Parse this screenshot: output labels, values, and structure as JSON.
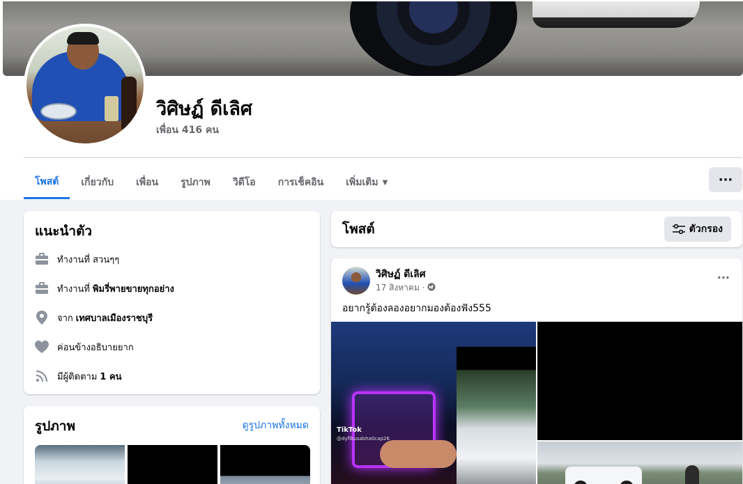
{
  "profile": {
    "name": "วิศิษฏ์ ดีเลิศ",
    "friends": "เพื่อน 416 คน"
  },
  "tabs": [
    {
      "label": "โพสต์",
      "active": true
    },
    {
      "label": "เกี่ยวกับ"
    },
    {
      "label": "เพื่อน"
    },
    {
      "label": "รูปภาพ"
    },
    {
      "label": "วิดีโอ"
    },
    {
      "label": "การเช็คอิน"
    },
    {
      "label": "เพิ่มเติม"
    }
  ],
  "more_button": "···",
  "intro": {
    "title": "แนะนำตัว",
    "items": [
      {
        "icon": "briefcase-icon",
        "prefix": "ทำงานที่ สวนๆๆ",
        "bold": ""
      },
      {
        "icon": "briefcase-icon",
        "prefix": "ทำงานที่",
        "bold": "พิมรี่พายขายทุกอย่าง"
      },
      {
        "icon": "location-pin-icon",
        "prefix": "จาก",
        "bold": "เทศบาลเมืองราชบุรี"
      },
      {
        "icon": "heart-icon",
        "prefix": "ค่อนข้างอธิบายยาก",
        "bold": ""
      },
      {
        "icon": "rss-icon",
        "prefix": "มีผู้ติดตาม",
        "bold": "1 คน"
      }
    ]
  },
  "photos": {
    "title": "รูปภาพ",
    "link": "ดูรูปภาพทั้งหมด"
  },
  "posts_header": {
    "title": "โพสต์",
    "filter_label": "ตัวกรอง"
  },
  "post": {
    "author": "วิศิษฏ์ ดีเลิศ",
    "date": "17 สิงหาคม ·",
    "text": "อยากรู้ต้องลองอยากมองต้องฟัง555",
    "dots": "···",
    "tiktok_label": "TikTok",
    "tiktok_id": "@dyflbusabha0cap26"
  }
}
